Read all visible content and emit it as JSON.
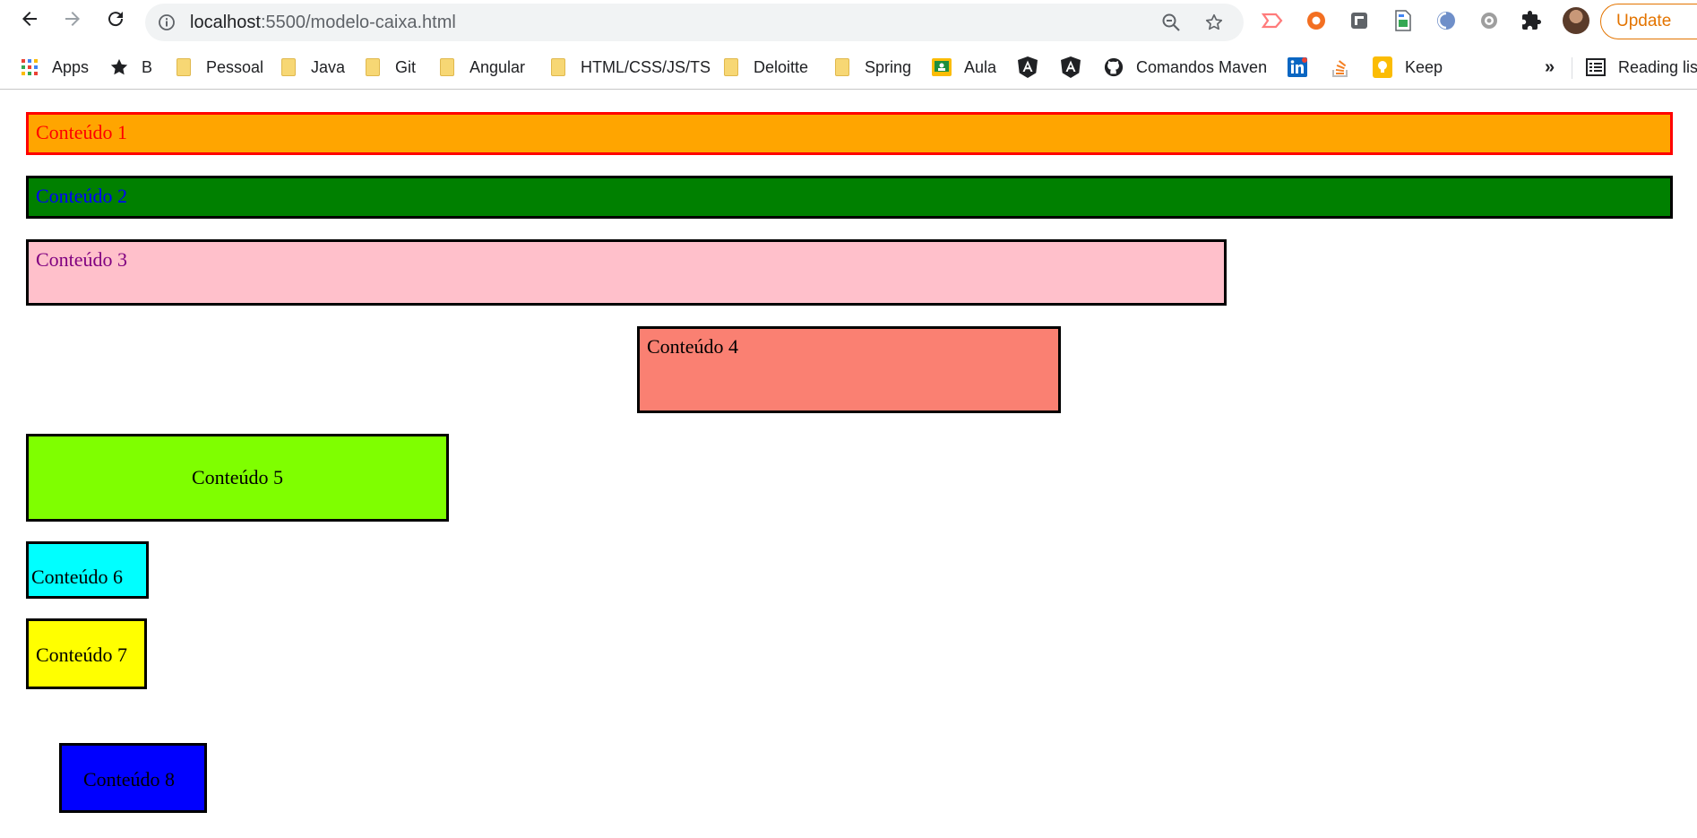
{
  "browser": {
    "url_host": "localhost",
    "url_path": ":5500/modelo-caixa.html",
    "update_label": "Update"
  },
  "bookmarks": [
    {
      "label": "Apps",
      "icon": "apps-grid-icon"
    },
    {
      "label": "B",
      "icon": "star-icon"
    },
    {
      "label": "Pessoal",
      "icon": "folder-icon"
    },
    {
      "label": "Java",
      "icon": "folder-icon"
    },
    {
      "label": "Git",
      "icon": "folder-icon"
    },
    {
      "label": "Angular",
      "icon": "folder-icon"
    },
    {
      "label": "HTML/CSS/JS/TS",
      "icon": "folder-icon"
    },
    {
      "label": "Deloitte",
      "icon": "folder-icon"
    },
    {
      "label": "Spring",
      "icon": "folder-icon"
    },
    {
      "label": "Aula",
      "icon": "google-classroom-icon"
    },
    {
      "label": "",
      "icon": "angular-icon"
    },
    {
      "label": "",
      "icon": "angular-icon"
    },
    {
      "label": "Comandos Maven",
      "icon": "github-icon"
    },
    {
      "label": "",
      "icon": "linkedin-icon"
    },
    {
      "label": "",
      "icon": "stackoverflow-icon"
    },
    {
      "label": "Keep",
      "icon": "keep-icon"
    },
    {
      "label": "Reading list",
      "icon": "reading-list-icon"
    }
  ],
  "overflow_label": "»",
  "content": {
    "box1": "Conteúdo 1",
    "box2": "Conteúdo 2",
    "box3": "Conteúdo 3",
    "box4": "Conteúdo 4",
    "box5": "Conteúdo 5",
    "box6": "Conteúdo 6",
    "box7": "Conteúdo 7",
    "box8": "Conteúdo 8"
  },
  "colors": {
    "box1_bg": "#ffa500",
    "box1_border": "#ff0000",
    "box1_text": "#ff0000",
    "box2_bg": "#008000",
    "box2_text": "#0000ff",
    "box3_bg": "#ffc0cb",
    "box3_text": "#800080",
    "box4_bg": "#fa8072",
    "box5_bg": "#7fff00",
    "box6_bg": "#00ffff",
    "box7_bg": "#ffff00",
    "box8_bg": "#0000ff",
    "update_accent": "#e37400"
  }
}
